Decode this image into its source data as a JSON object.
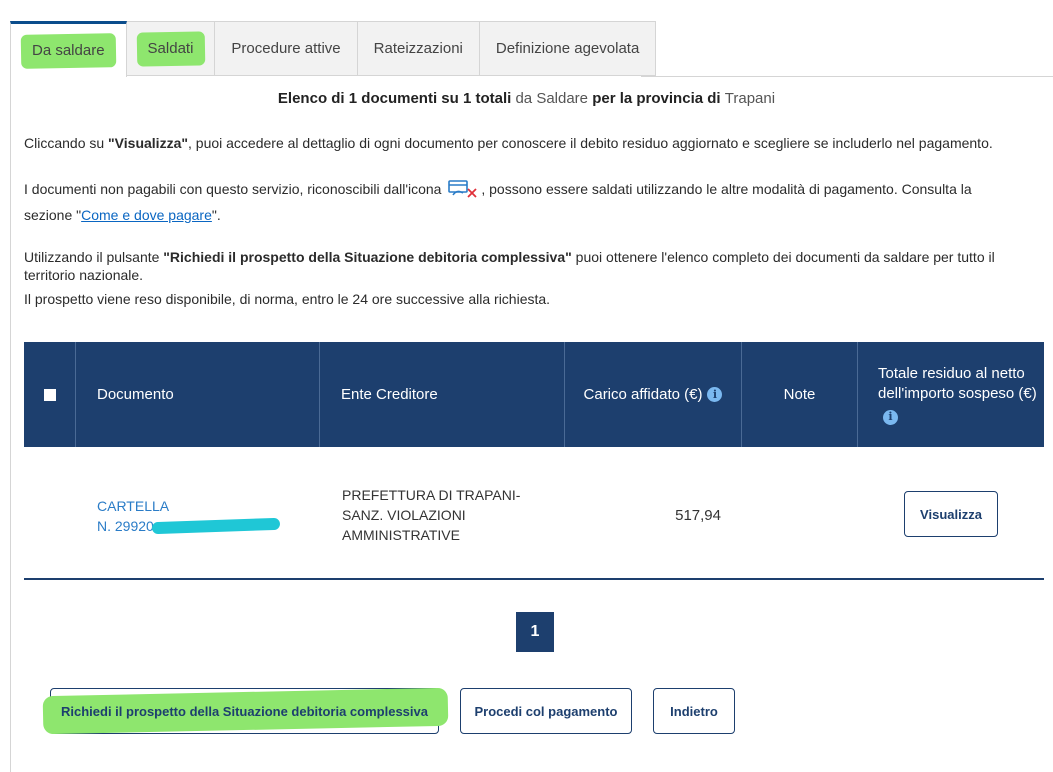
{
  "tabs": [
    {
      "label": "Da saldare",
      "active": true
    },
    {
      "label": "Saldati",
      "active": false
    },
    {
      "label": "Procedure attive",
      "active": false
    },
    {
      "label": "Rateizzazioni",
      "active": false
    },
    {
      "label": "Definizione agevolata",
      "active": false
    }
  ],
  "heading": {
    "part1": "Elenco di 1 documenti su 1 totali ",
    "part2": "da Saldare",
    "part3": " per la provincia di ",
    "part4": "Trapani"
  },
  "info": {
    "p1_prefix": "Cliccando su ",
    "p1_bold": "\"Visualizza\"",
    "p1_suffix": ", puoi accedere al dettaglio di ogni documento per conoscere il debito residuo aggiornato e scegliere se includerlo nel pagamento.",
    "p2_prefix": "I documenti non pagabili con questo servizio, riconoscibili dall'icona ",
    "p2_suffix": ", possono essere saldati utilizzando le altre modalità di pagamento. Consulta la",
    "p3_prefix": "sezione \"",
    "p3_link": "Come e dove pagare",
    "p3_suffix": "\".",
    "p4_prefix": "Utilizzando il pulsante ",
    "p4_bold": "\"Richiedi il prospetto della Situazione debitoria complessiva\"",
    "p4_suffix": " puoi ottenere l'elenco completo dei documenti da saldare per tutto il territorio nazionale.",
    "p5": "Il prospetto viene reso disponibile, di norma, entro le 24 ore successive alla richiesta."
  },
  "table": {
    "headers": {
      "documento": "Documento",
      "ente": "Ente Creditore",
      "carico": "Carico affidato (€)",
      "note": "Note",
      "totale": "Totale residuo al netto dell'importo sospeso (€)"
    },
    "rows": [
      {
        "doc_line1": "CARTELLA",
        "doc_line2": "N. 29920",
        "ente_line1": "PREFETTURA DI TRAPANI-",
        "ente_line2": "SANZ. VIOLAZIONI",
        "ente_line3": "AMMINISTRATIVE",
        "carico": "517,94",
        "note": "",
        "action": "Visualizza"
      }
    ]
  },
  "pagination": {
    "current": "1"
  },
  "actions": {
    "prospetto": "Richiedi il prospetto della Situazione debitoria complessiva",
    "procedi": "Procedi col pagamento",
    "indietro": "Indietro"
  },
  "colors": {
    "header_bg": "#1d3f6e",
    "link": "#2a7cc7",
    "highlight": "#8ee66e",
    "redaction": "#1fc7d6"
  }
}
